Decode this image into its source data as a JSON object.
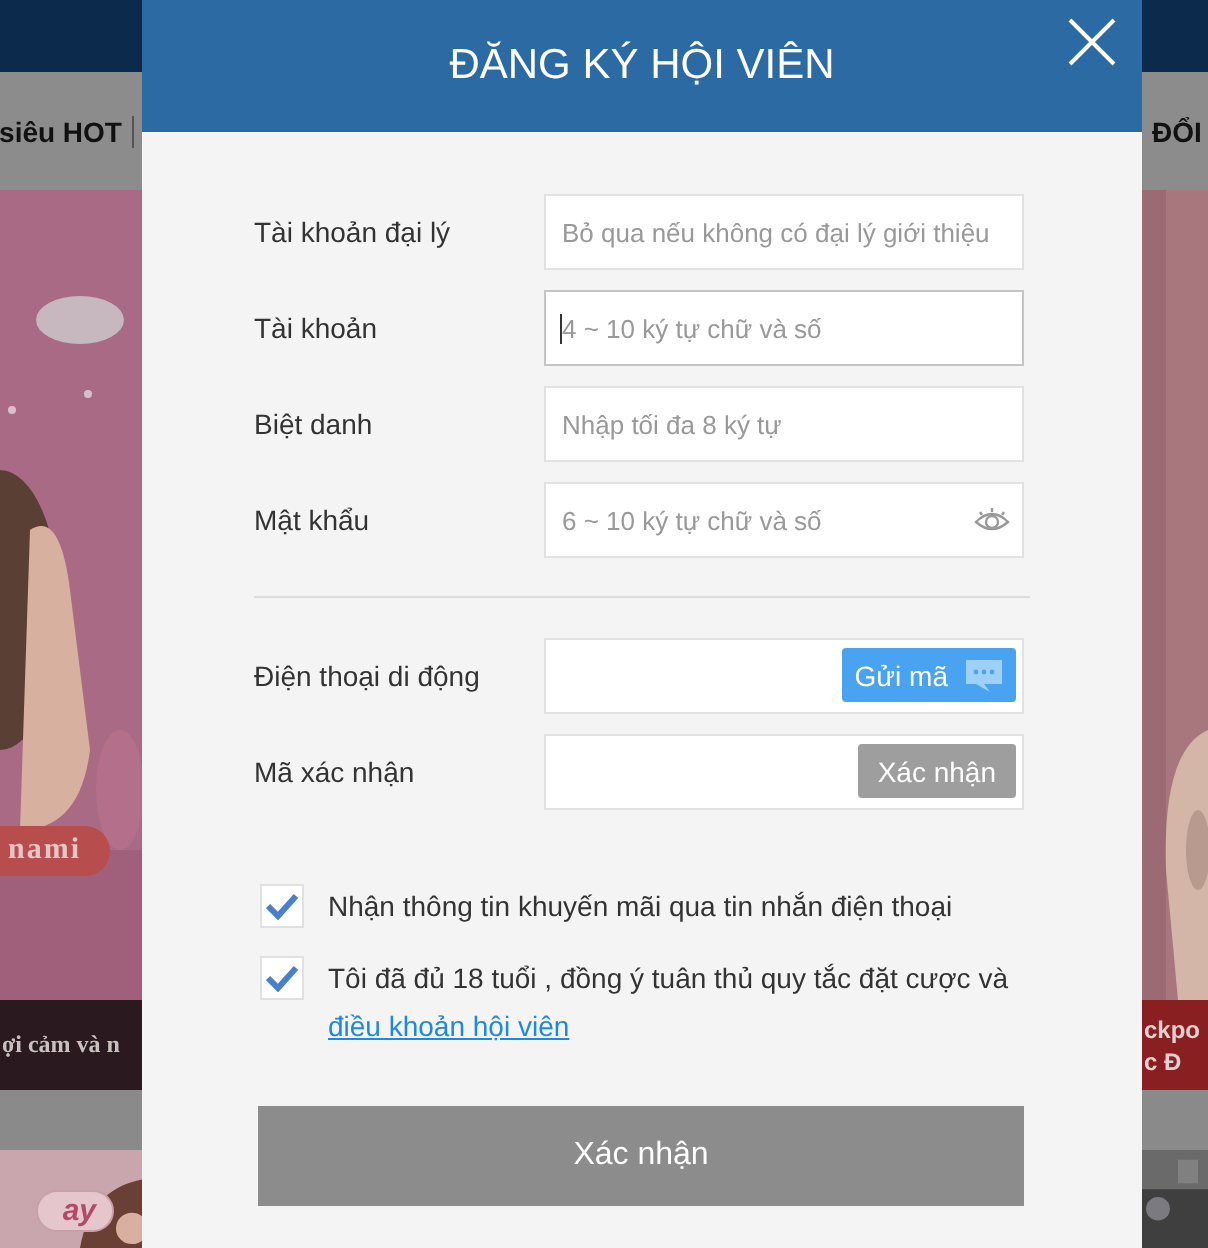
{
  "background": {
    "nav_left": "siêu HOT",
    "nav_right": "ĐỔI",
    "banner_tag": "nami",
    "caption_left": "ợi cảm và n",
    "caption_right": [
      "ckpo",
      "c Đ"
    ],
    "bottom_tag": "ay"
  },
  "dialog": {
    "title": "ĐĂNG KÝ HỘI VIÊN",
    "fields": [
      {
        "kind": "text",
        "label": "Tài khoản đại lý",
        "placeholder": "Bỏ qua nếu không có đại lý giới thiệu",
        "focused": false
      },
      {
        "kind": "text",
        "label": "Tài khoản",
        "placeholder": "4 ~ 10 ký tự chữ và số",
        "focused": true
      },
      {
        "kind": "text",
        "label": "Biệt danh",
        "placeholder": "Nhập tối đa 8 ký tự",
        "focused": false
      },
      {
        "kind": "password",
        "label": "Mật khẩu",
        "placeholder": "6 ~ 10 ký tự chữ và số",
        "focused": false
      },
      {
        "kind": "divider"
      },
      {
        "kind": "sms",
        "label": "Điện thoại di động",
        "button": "Gửi mã",
        "focused": false
      },
      {
        "kind": "verify",
        "label": "Mã xác nhận",
        "button": "Xác nhận",
        "focused": false
      }
    ],
    "checkboxes": [
      {
        "text": "Nhận thông tin khuyến mãi qua tin nhắn điện thoại",
        "checked": true
      },
      {
        "text": "Tôi đã đủ 18 tuổi , đồng ý tuân thủ quy tắc đặt cược và",
        "link": "điều khoản hội viên",
        "checked": true
      }
    ],
    "submit": "Xác nhận"
  }
}
